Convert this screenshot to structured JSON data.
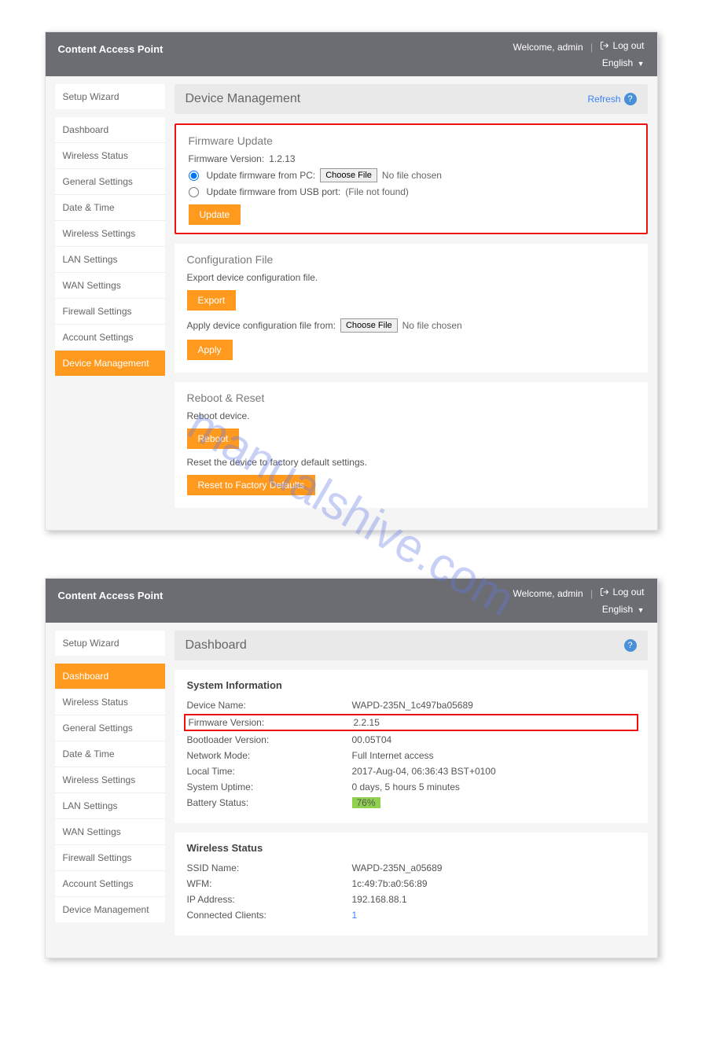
{
  "watermark": "manualshive.com",
  "shared": {
    "brand": "Content Access Point",
    "welcome": "Welcome, admin",
    "logout": "Log out",
    "language": "English"
  },
  "screen1": {
    "nav": {
      "group1": [
        "Setup Wizard"
      ],
      "group2": [
        "Dashboard",
        "Wireless Status",
        "General Settings",
        "Date & Time",
        "Wireless Settings",
        "LAN Settings",
        "WAN Settings",
        "Firewall Settings",
        "Account Settings",
        "Device Management"
      ],
      "activeIndex": 9
    },
    "title": "Device Management",
    "refresh": "Refresh",
    "firmware": {
      "heading": "Firmware Update",
      "version_label": "Firmware Version:",
      "version_value": "1.2.13",
      "opt_pc": "Update firmware from PC:",
      "choose_file": "Choose File",
      "no_file": "No file chosen",
      "opt_usb_label": "Update firmware from USB port:",
      "opt_usb_status": "(File not found)",
      "update_btn": "Update"
    },
    "config": {
      "heading": "Configuration File",
      "export_label": "Export device configuration file.",
      "export_btn": "Export",
      "apply_label": "Apply device configuration file from:",
      "choose_file": "Choose File",
      "no_file": "No file chosen",
      "apply_btn": "Apply"
    },
    "reboot": {
      "heading": "Reboot & Reset",
      "reboot_label": "Reboot device.",
      "reboot_btn": "Reboot",
      "reset_label": "Reset the device to factory default settings.",
      "reset_btn": "Reset to Factory Defaults"
    }
  },
  "screen2": {
    "nav": {
      "group1": [
        "Setup Wizard"
      ],
      "group2": [
        "Dashboard",
        "Wireless Status",
        "General Settings",
        "Date & Time",
        "Wireless Settings",
        "LAN Settings",
        "WAN Settings",
        "Firewall Settings",
        "Account Settings",
        "Device Management"
      ],
      "activeIndex": 0
    },
    "title": "Dashboard",
    "sysinfo": {
      "heading": "System Information",
      "rows": [
        {
          "label": "Device Name:",
          "value": "WAPD-235N_1c497ba05689"
        },
        {
          "label": "Firmware Version:",
          "value": "2.2.15",
          "highlight": true
        },
        {
          "label": "Bootloader Version:",
          "value": "00.05T04"
        },
        {
          "label": "Network Mode:",
          "value": "Full Internet access"
        },
        {
          "label": "Local Time:",
          "value": "2017-Aug-04, 06:36:43 BST+0100"
        },
        {
          "label": "System Uptime:",
          "value": "0 days, 5 hours 5 minutes"
        },
        {
          "label": "Battery Status:",
          "value": "76%",
          "battery": true
        }
      ]
    },
    "wireless": {
      "heading": "Wireless Status",
      "rows": [
        {
          "label": "SSID Name:",
          "value": "WAPD-235N_a05689"
        },
        {
          "label": "WFM:",
          "value": "1c:49:7b:a0:56:89"
        },
        {
          "label": "IP Address:",
          "value": "192.168.88.1"
        },
        {
          "label": "Connected Clients:",
          "value": "1",
          "link": true
        }
      ]
    }
  }
}
